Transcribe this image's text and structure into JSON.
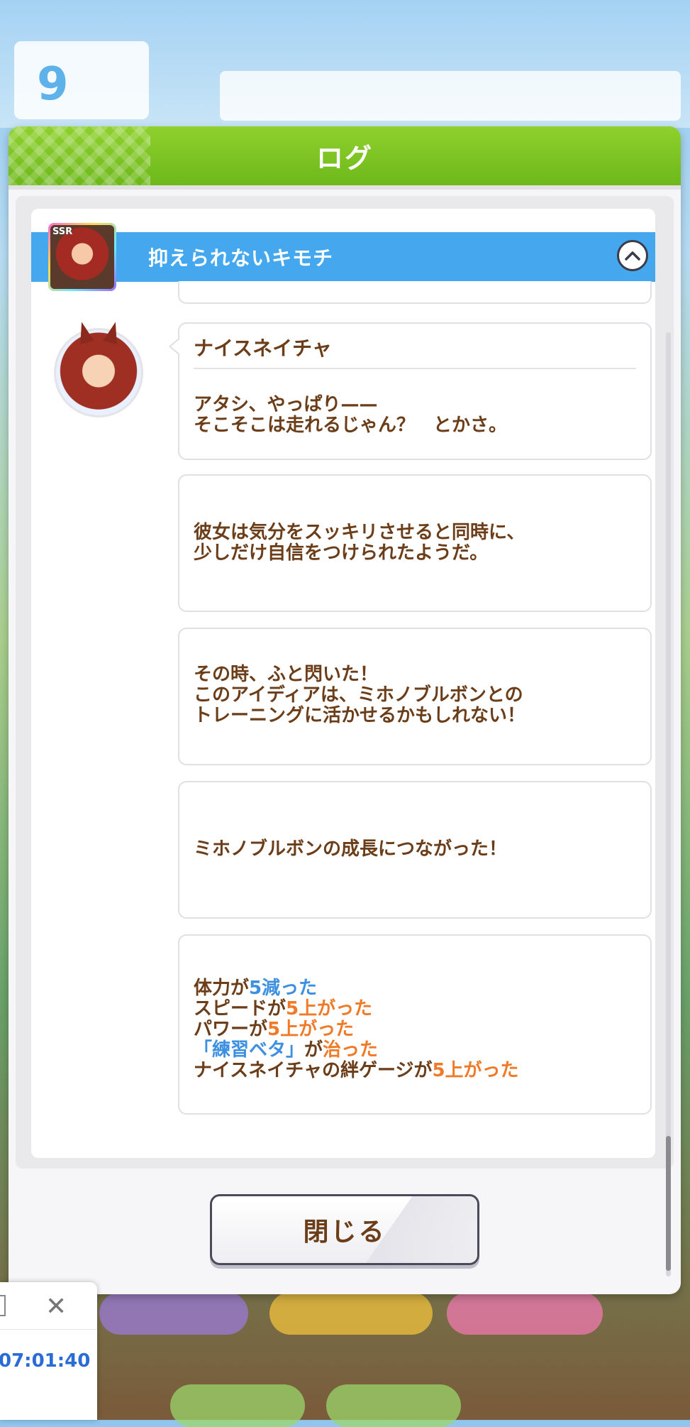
{
  "dialog": {
    "title": "ログ",
    "close_label": "閉じる"
  },
  "event": {
    "title": "抑えられないキモチ",
    "card_rarity": "SSR"
  },
  "log_entries": [
    {
      "speaker": "ナイスネイチャ",
      "lines": [
        "アタシ、やっぱり——",
        "そこそこは走れるじゃん？　とかさ。"
      ]
    },
    {
      "lines": [
        "彼女は気分をスッキリさせると同時に、",
        "少しだけ自信をつけられたようだ。"
      ]
    },
    {
      "lines": [
        "その時、ふと閃いた！",
        "このアイディアは、ミホノブルボンとの",
        "トレーニングに活かせるかもしれない！"
      ]
    },
    {
      "lines": [
        "ミホノブルボンの成長につながった！"
      ]
    }
  ],
  "results": {
    "stamina_label": "体力が",
    "stamina_value": "5減った",
    "speed_label": "スピードが",
    "speed_value": "5上がった",
    "power_label": "パワーが",
    "power_value": "5上がった",
    "status_name": "「練習ベタ」",
    "status_label": "が",
    "status_value": "治った",
    "bond_label": "ナイスネイチャの絆ゲージが",
    "bond_value": "5上がった"
  },
  "background": {
    "turn_number": "9"
  },
  "overlay": {
    "timer": "07:01:40"
  },
  "colors": {
    "header_green": "#7cc41f",
    "event_bar_blue": "#45a8ee",
    "text_brown": "#6b3d18",
    "decrease_blue": "#3d8fe0",
    "increase_orange": "#f07a27"
  }
}
